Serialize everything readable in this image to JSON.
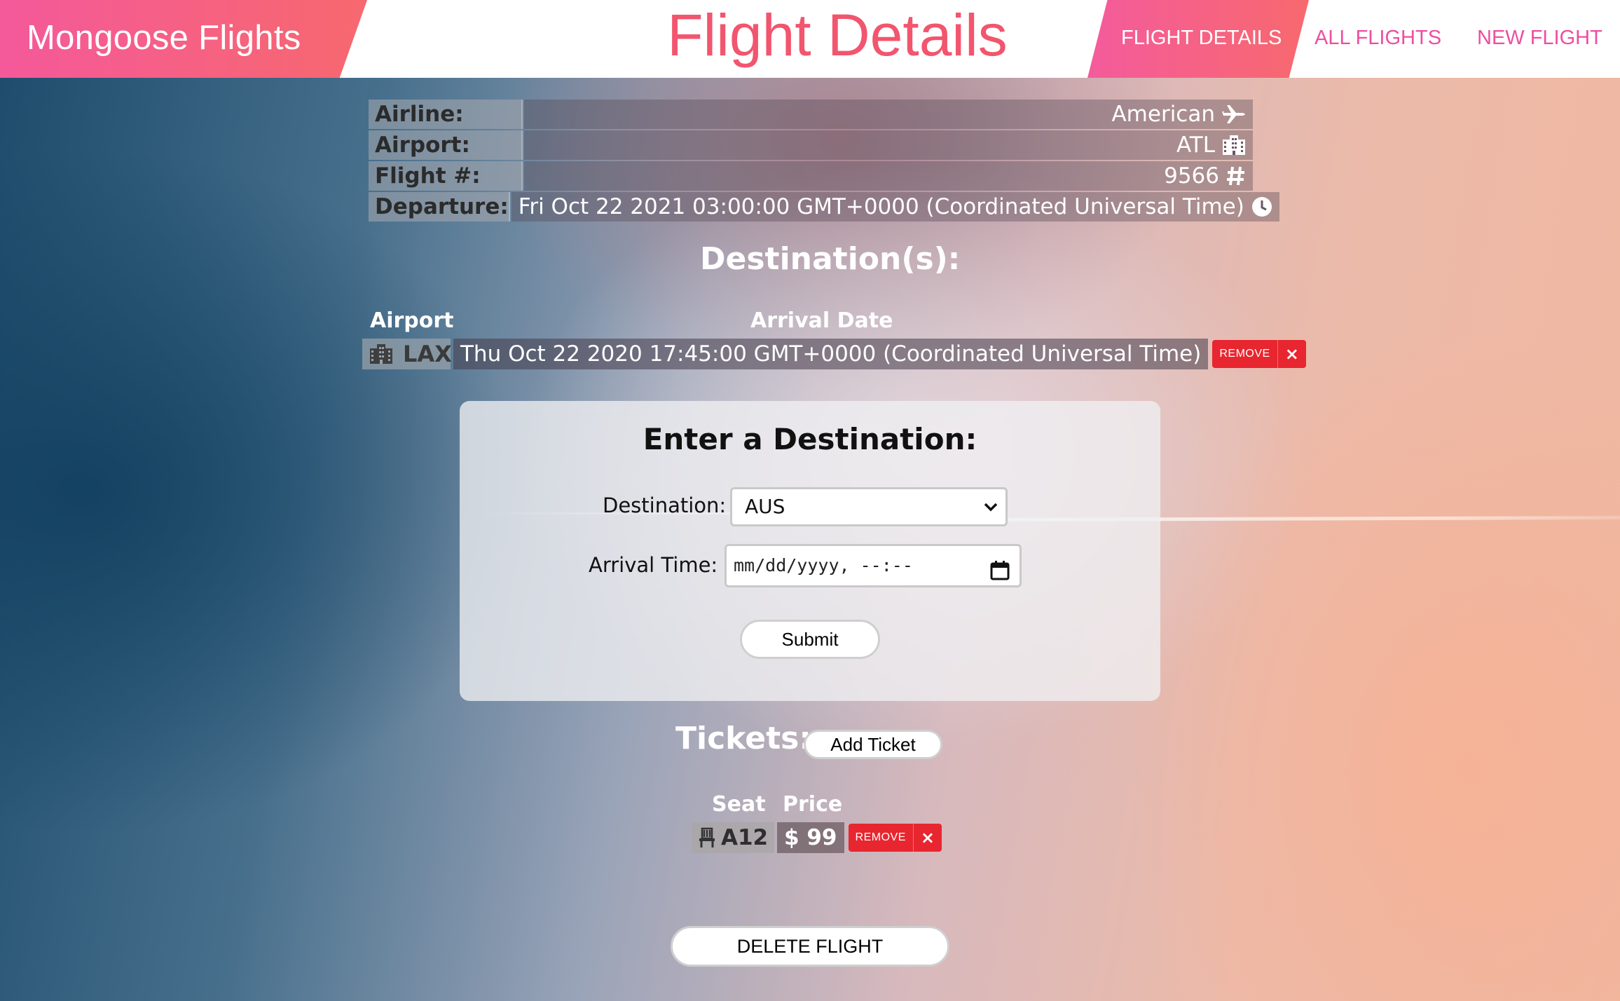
{
  "header": {
    "brand": "Mongoose Flights",
    "title": "Flight Details",
    "nav": {
      "flight_details": "FLIGHT DETAILS",
      "all_flights": "ALL FLIGHTS",
      "new_flight": "NEW FLIGHT"
    }
  },
  "details": {
    "airline_label": "Airline:",
    "airline_value": "American",
    "airline_icon": "plane-icon",
    "airport_label": "Airport:",
    "airport_value": "ATL",
    "airport_icon": "building-icon",
    "flight_label": "Flight #:",
    "flight_value": "9566",
    "flight_icon": "hashtag-icon",
    "departure_label": "Departure:",
    "departure_value": "Fri Oct 22 2021 03:00:00 GMT+0000 (Coordinated Universal Time)",
    "departure_icon": "clock-icon"
  },
  "destinations": {
    "title": "Destination(s):",
    "col_airport": "Airport",
    "col_arrival": "Arrival Date",
    "rows": [
      {
        "airport": "LAX",
        "arrival": "Thu Oct 22 2020 17:45:00 GMT+0000 (Coordinated Universal Time)",
        "remove_label": "REMOVE",
        "remove_x": "×"
      }
    ]
  },
  "form": {
    "title": "Enter a Destination:",
    "destination_label": "Destination:",
    "destination_value": "AUS",
    "arrival_label": "Arrival Time:",
    "arrival_placeholder": "mm/dd/yyyy, --:--",
    "submit_label": "Submit"
  },
  "tickets": {
    "title": "Tickets:",
    "add_label": "Add Ticket",
    "col_seat": "Seat",
    "col_price": "Price",
    "rows": [
      {
        "seat": "A12",
        "price": "$ 99",
        "remove_label": "REMOVE",
        "remove_x": "×"
      }
    ]
  },
  "delete_label": "DELETE FLIGHT",
  "colors": {
    "brand_gradient_start": "#f4599a",
    "brand_gradient_end": "#f7686e",
    "title_color": "#f2556e",
    "nav_link_color": "#ee4ea0",
    "remove_red": "#e8262f"
  }
}
